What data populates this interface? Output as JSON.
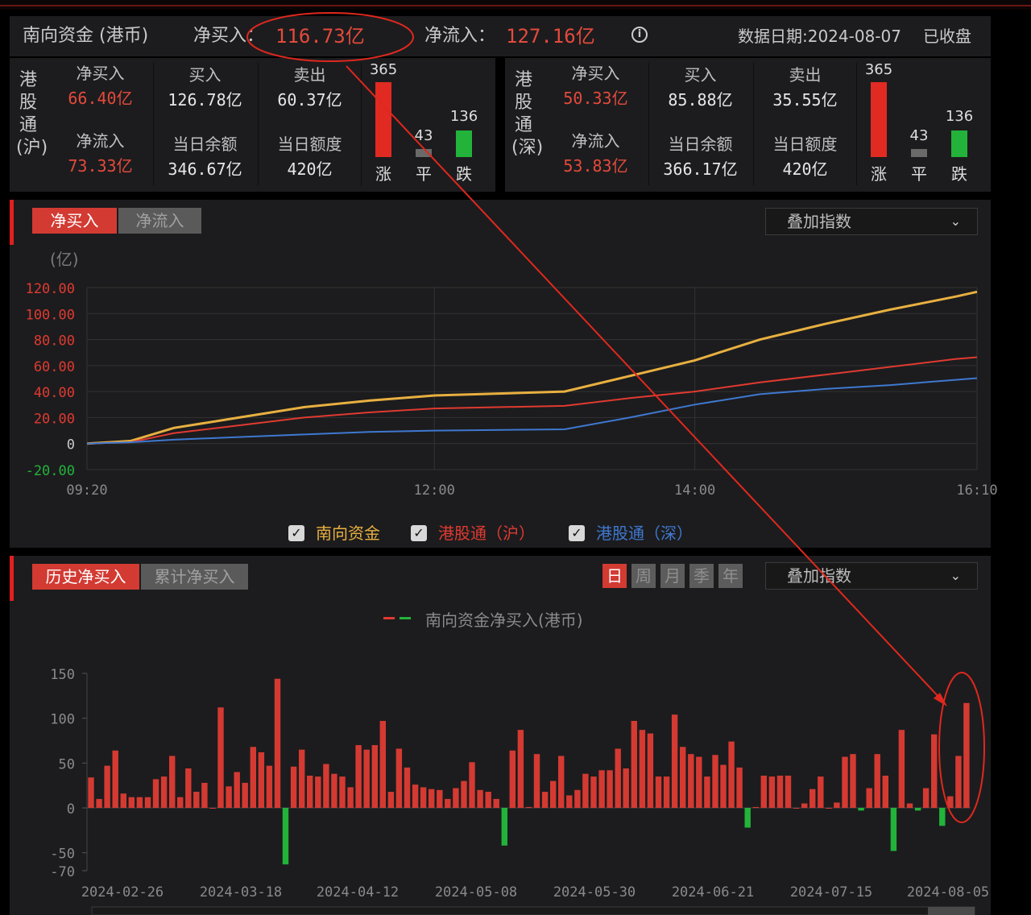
{
  "header": {
    "title": "南向资金 (港币)",
    "net_buy_label": "净买入：",
    "net_buy_value": "116.73亿",
    "net_inflow_label": "净流入：",
    "net_inflow_value": "127.16亿",
    "info_icon": "i",
    "date_label": "数据日期:2024-08-07",
    "status": "已收盘"
  },
  "panels": [
    {
      "name": "港股通(沪)",
      "net_buy_label": "净买入",
      "net_buy": "66.40亿",
      "buy_label": "买入",
      "buy": "126.78亿",
      "sell_label": "卖出",
      "sell": "60.37亿",
      "net_inflow_label": "净流入",
      "net_inflow": "73.33亿",
      "balance_label": "当日余额",
      "balance": "346.67亿",
      "quota_label": "当日额度",
      "quota": "420亿",
      "up_count": "365",
      "flat_count": "43",
      "down_count": "136",
      "up_label": "涨",
      "flat_label": "平",
      "down_label": "跌"
    },
    {
      "name": "港股通(深)",
      "net_buy_label": "净买入",
      "net_buy": "50.33亿",
      "buy_label": "买入",
      "buy": "85.88亿",
      "sell_label": "卖出",
      "sell": "35.55亿",
      "net_inflow_label": "净流入",
      "net_inflow": "53.83亿",
      "balance_label": "当日余额",
      "balance": "366.17亿",
      "quota_label": "当日额度",
      "quota": "420亿",
      "up_count": "365",
      "flat_count": "43",
      "down_count": "136",
      "up_label": "涨",
      "flat_label": "平",
      "down_label": "跌"
    }
  ],
  "intraday": {
    "tab_active": "净买入",
    "tab_inactive": "净流入",
    "overlay_dropdown": "叠加指数",
    "unit": "(亿)",
    "legend": [
      {
        "label": "南向资金",
        "color": "#e8b040",
        "checked": true
      },
      {
        "label": "港股通（沪）",
        "color": "#e03a30",
        "checked": true
      },
      {
        "label": "港股通（深）",
        "color": "#3f78d0",
        "checked": true
      }
    ]
  },
  "history": {
    "tab_active": "历史净买入",
    "tab_inactive": "累计净买入",
    "periods": [
      "日",
      "周",
      "月",
      "季",
      "年"
    ],
    "active_period": "日",
    "overlay_dropdown": "叠加指数",
    "legend_label": "南向资金净买入(港币)"
  },
  "chart_data": [
    {
      "type": "line",
      "ylabel": "(亿)",
      "ylim": [
        -20,
        120
      ],
      "yticks": [
        "120.00",
        "100.00",
        "80.00",
        "60.00",
        "40.00",
        "20.00",
        "0",
        "-20.00"
      ],
      "xticks": [
        "09:20",
        "12:00",
        "14:00",
        "16:10"
      ],
      "x": [
        "09:20",
        "09:40",
        "10:00",
        "10:30",
        "11:00",
        "11:30",
        "12:00",
        "13:00",
        "13:30",
        "14:00",
        "14:30",
        "15:00",
        "15:30",
        "16:00",
        "16:10"
      ],
      "series": [
        {
          "name": "南向资金",
          "color": "#e8b040",
          "values": [
            0,
            2,
            12,
            20,
            28,
            33,
            37,
            40,
            52,
            64,
            80,
            92,
            103,
            113,
            116.73
          ]
        },
        {
          "name": "港股通（沪）",
          "color": "#e03a30",
          "values": [
            0,
            1,
            8,
            14,
            20,
            24,
            27,
            29,
            35,
            40,
            47,
            53,
            59,
            65,
            66.4
          ]
        },
        {
          "name": "港股通（深）",
          "color": "#3f78d0",
          "values": [
            0,
            1,
            3,
            5,
            7,
            9,
            10,
            11,
            20,
            30,
            38,
            42,
            45,
            49,
            50.33
          ]
        }
      ]
    },
    {
      "type": "bar",
      "title": "南向资金净买入(港币)",
      "ylim": [
        -70,
        150
      ],
      "yticks": [
        "150",
        "100",
        "50",
        "0",
        "-50",
        "-70"
      ],
      "xticks": [
        "2024-02-26",
        "2024-03-18",
        "2024-04-12",
        "2024-05-08",
        "2024-05-30",
        "2024-06-21",
        "2024-07-15",
        "2024-08-05"
      ],
      "values": [
        34,
        10,
        47,
        64,
        16,
        12,
        12,
        12,
        32,
        35,
        58,
        12,
        44,
        18,
        28,
        0,
        112,
        24,
        40,
        28,
        68,
        62,
        47,
        144,
        -63,
        46,
        65,
        36,
        35,
        49,
        38,
        35,
        23,
        70,
        65,
        70,
        97,
        18,
        66,
        45,
        26,
        23,
        21,
        20,
        10,
        22,
        30,
        51,
        20,
        18,
        10,
        -42,
        64,
        87,
        1,
        60,
        18,
        30,
        58,
        14,
        20,
        38,
        35,
        42,
        42,
        66,
        44,
        97,
        87,
        83,
        35,
        35,
        104,
        68,
        60,
        57,
        35,
        59,
        48,
        74,
        45,
        -22,
        1,
        36,
        35,
        36,
        36,
        0,
        5,
        21,
        35,
        0,
        6,
        57,
        60,
        -3,
        22,
        60,
        36,
        -48,
        87,
        5,
        -3,
        22,
        82,
        -20,
        13,
        58,
        117
      ]
    }
  ]
}
